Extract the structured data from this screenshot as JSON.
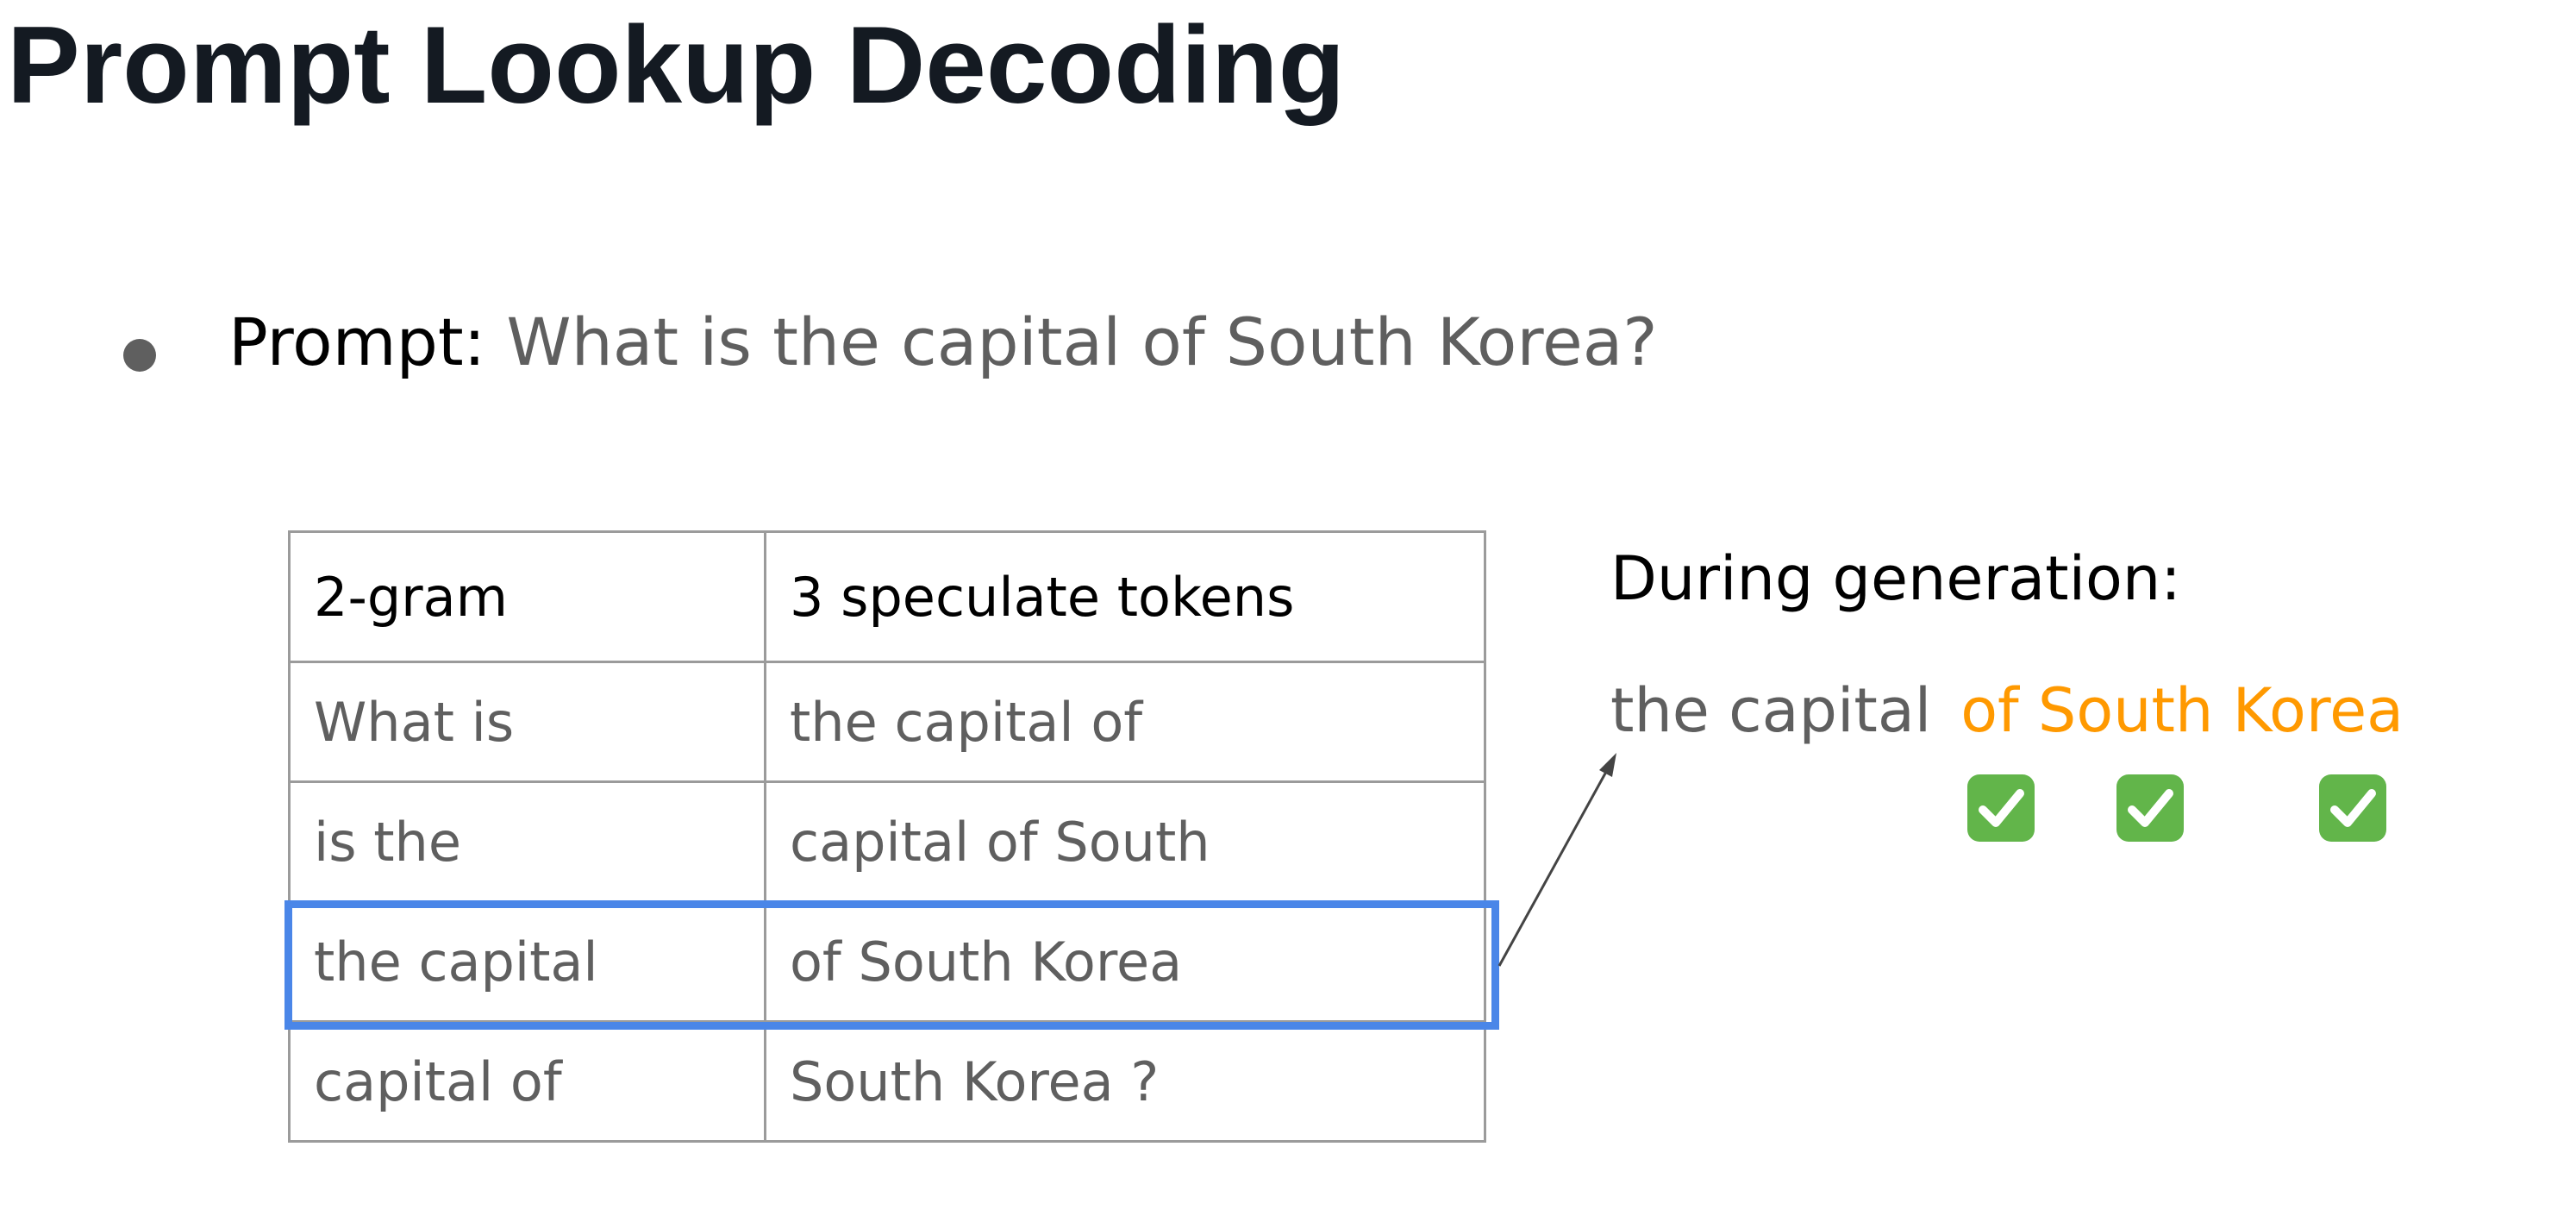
{
  "title": "Prompt Lookup Decoding",
  "prompt": {
    "label": "Prompt:",
    "text": "What is the capital of South Korea?"
  },
  "table": {
    "headers": [
      "2-gram",
      "3 speculate tokens"
    ],
    "rows": [
      [
        "What is",
        "the capital of"
      ],
      [
        "is the",
        "capital of South"
      ],
      [
        "the capital",
        "of South Korea"
      ],
      [
        "capital of",
        "South Korea ?"
      ]
    ],
    "highlighted_row": 2
  },
  "generation": {
    "label": "During generation:",
    "prefix": "the capital",
    "speculated": "of South Korea",
    "checks": [
      "check-mark-icon",
      "check-mark-icon",
      "check-mark-icon"
    ]
  },
  "colors": {
    "highlight_box": "#4a86e8",
    "speculated_text": "#ff9900",
    "check": "#62b54a"
  }
}
